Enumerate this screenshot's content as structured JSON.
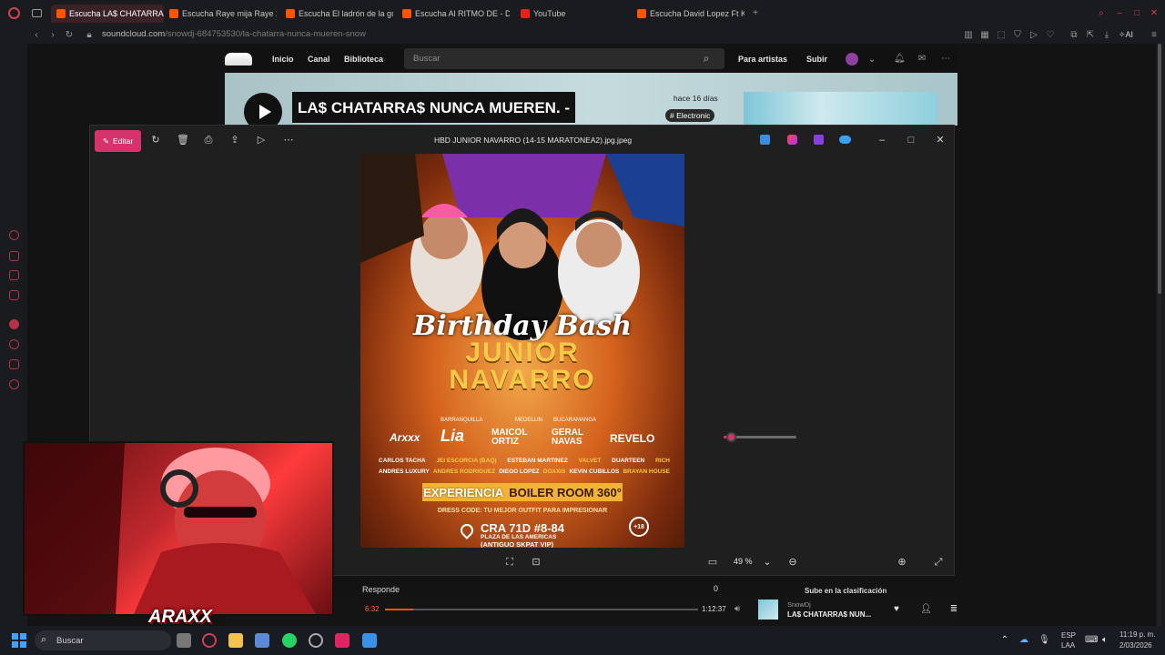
{
  "browser": {
    "tabs": [
      {
        "label": "Escucha LA$ CHATARRA$",
        "active": true
      },
      {
        "label": "Escucha Raye mija Raye 2"
      },
      {
        "label": "Escucha El ladrón de la gu"
      },
      {
        "label": "Escucha Al RITMO DE - D"
      },
      {
        "label": "YouTube"
      },
      {
        "label": "Escucha David Lopez Ft K"
      }
    ],
    "url_domain": "soundcloud.com",
    "url_path": "/snowdj-684753530/la-chatarra-nunca-mueren-snow",
    "ai_label": "AI"
  },
  "soundcloud": {
    "nav": {
      "home": "Inicio",
      "feed": "Canal",
      "library": "Biblioteca",
      "artists": "Para artistas",
      "upload": "Subir"
    },
    "search_placeholder": "Buscar",
    "track_title": "LA$ CHATARRA$ NUNCA MUEREN. -",
    "ago": "hace 16 días",
    "tag": "# Electronic",
    "comment_label": "Responde",
    "comment_count": "0",
    "side_label": "Sube en la clasificación"
  },
  "viewer": {
    "edit_label": "Editar",
    "filename": "HBD JUNIOR NAVARRO (14-15 MARATONEA2).jpg.jpeg",
    "zoom": "49 %",
    "zoom_level": 0.1
  },
  "poster": {
    "title_1": "Birthday Bash",
    "title_2": "JUNIOR",
    "title_3": "NAVARRO",
    "cities": [
      "BARRANQUILLA",
      "MEDELLIN",
      "BUCARAMANGA"
    ],
    "headliners": [
      "Arxxx",
      "Lia",
      "MAICOL ORTIZ",
      "GERAL NAVAS",
      "REVELO"
    ],
    "lineup_1": [
      "CARLOS TACHA",
      "JEI ESCORCIA (BAQ)",
      "ESTEBAN MARTINEZ",
      "VALVET",
      "DUARTEEN",
      "RICH"
    ],
    "lineup_2": [
      "ANDRES LUXURY",
      "ANDRES RODRIGUEZ",
      "DIEGO LOPEZ",
      "DOXXIS",
      "KEVIN CUBILLOS",
      "BRAYAN HOUSE"
    ],
    "experience_a": "EXPERIENCIA",
    "experience_b": "BOILER ROOM 360°",
    "dress_code": "DRESS CODE: TU MEJOR OUTFIT PARA IMPRESIONAR",
    "address": "CRA 71D #8-84",
    "venue_1": "PLAZA DE LAS AMERICAS",
    "venue_2": "(ANTIGUO SKPAT VIP)",
    "age": "+18"
  },
  "player": {
    "elapsed": "6:32",
    "duration": "1:12:37",
    "progress": 0.09,
    "artist": "SnowDj",
    "title": "LA$ CHATARRA$ NUN..."
  },
  "webcam": {
    "watermark": "ARAXX"
  },
  "taskbar": {
    "search_placeholder": "Buscar",
    "lang_1": "ESP",
    "lang_2": "LAA",
    "time": "11:19 p. m.",
    "date": "2/03/2026"
  },
  "colors": {
    "accent": "#d6336c",
    "soundcloud_orange": "#ff5500",
    "opera_red": "#b5324a"
  }
}
